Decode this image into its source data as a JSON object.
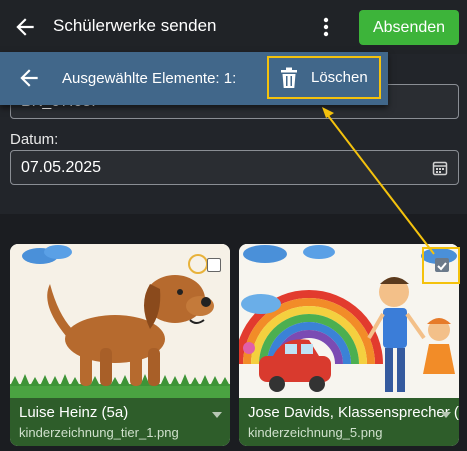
{
  "appbar": {
    "back_icon": "arrow-left-icon",
    "title": "Schülerwerke senden",
    "menu_icon": "kebab-menu-icon",
    "send_label": "Absenden"
  },
  "form": {
    "title_value": "BK_07.05.",
    "date_label": "Datum:",
    "date_value": "07.05.2025",
    "date_icon": "calendar-icon"
  },
  "selection_bar": {
    "back_icon": "arrow-left-icon",
    "text": "Ausgewählte Elemente: 1:",
    "delete_icon": "trash-icon",
    "delete_label": "Löschen"
  },
  "works": [
    {
      "name": "Luise Heinz (5a)",
      "file": "kinderzeichnung_tier_1.png",
      "selected": false,
      "image": "child-drawing-brown-dog"
    },
    {
      "name": "Jose Davids, Klassensprecher (",
      "file": "kinderzeichnung_5.png",
      "selected": true,
      "image": "child-drawing-rainbow-family-car"
    }
  ],
  "colors": {
    "appbar": "#202327",
    "send_button": "#3db43a",
    "selection_bar": "#41678a",
    "card_footer": "#2e5d2a",
    "highlight": "#f4c20d"
  }
}
